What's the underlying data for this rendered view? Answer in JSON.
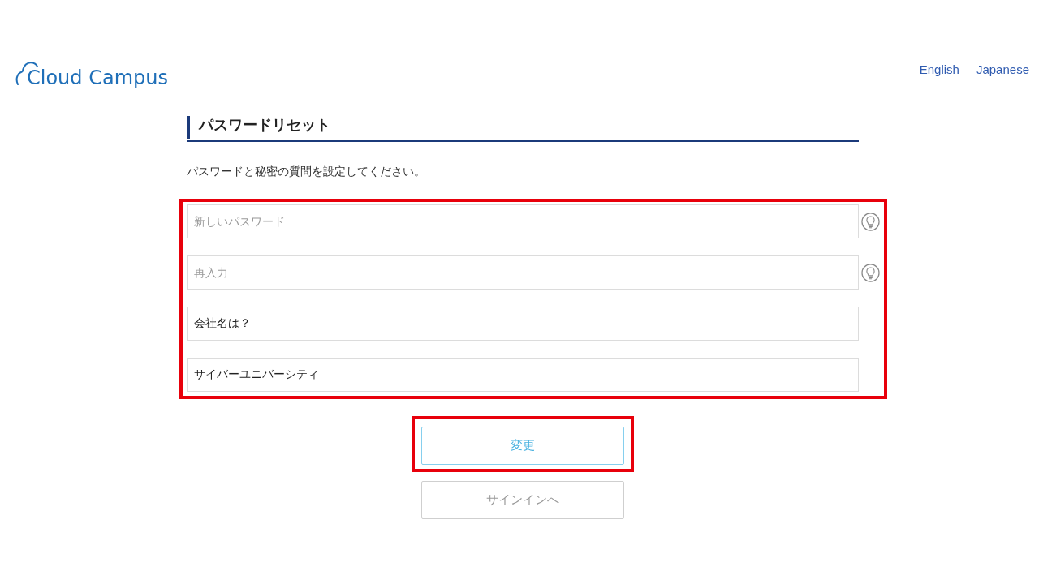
{
  "header": {
    "logo": {
      "text": "Cloud Campus"
    },
    "languages": [
      {
        "label": "English"
      },
      {
        "label": "Japanese"
      }
    ]
  },
  "page": {
    "title": "パスワードリセット",
    "description": "パスワードと秘密の質問を設定してください。"
  },
  "form": {
    "highlighted": true,
    "fields": [
      {
        "kind": "password",
        "placeholder": "新しいパスワード",
        "hint_icon": true
      },
      {
        "kind": "password",
        "placeholder": "再入力",
        "hint_icon": true
      },
      {
        "kind": "text",
        "value": "会社名は？",
        "hint_icon": false
      },
      {
        "kind": "text",
        "value": "サイバーユニバーシティ",
        "hint_icon": false
      }
    ]
  },
  "buttons": [
    {
      "kind": "primary",
      "label": "変更",
      "highlighted": true
    },
    {
      "kind": "secondary",
      "label": "サインインへ",
      "highlighted": false
    }
  ]
}
